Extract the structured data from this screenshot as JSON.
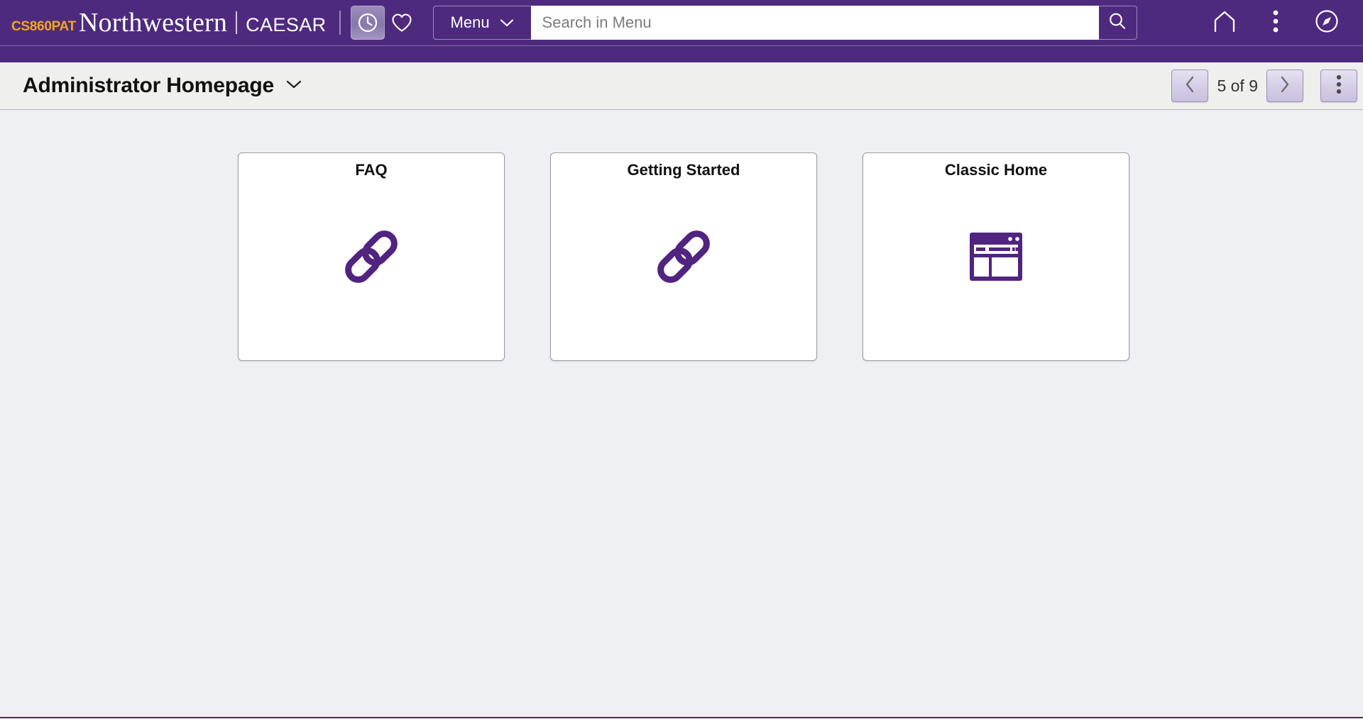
{
  "header": {
    "brand_prefix": "CS860PAT",
    "brand_main": "Northwestern",
    "brand_sub": "CAESAR",
    "recent_icon": "clock-icon",
    "favorites_icon": "heart-icon",
    "menu_label": "Menu",
    "menu_caret_icon": "chevron-down-icon",
    "search": {
      "placeholder": "Search in Menu",
      "value": "",
      "submit_icon": "search-icon"
    },
    "right_icons": [
      {
        "name": "home-icon",
        "label": "Home"
      },
      {
        "name": "actions-kebab-icon",
        "label": "Actions List"
      },
      {
        "name": "navbar-compass-icon",
        "label": "NavBar"
      }
    ]
  },
  "titlebar": {
    "title": "Administrator Homepage",
    "title_caret_icon": "chevron-down-icon",
    "pager": {
      "prev_icon": "chevron-left-icon",
      "count_label": "5 of 9",
      "next_icon": "chevron-right-icon",
      "more_icon": "kebab-icon"
    }
  },
  "main": {
    "tiles": [
      {
        "title": "FAQ",
        "icon": "link-chain-icon"
      },
      {
        "title": "Getting Started",
        "icon": "link-chain-icon"
      },
      {
        "title": "Classic Home",
        "icon": "classic-window-icon"
      }
    ]
  },
  "colors": {
    "brand_purple": "#4e2a7e",
    "brand_gold": "#f0a818",
    "page_background": "#eff0f3",
    "titlebar_background": "#efefed",
    "tile_icon_purple": "#50247f"
  }
}
